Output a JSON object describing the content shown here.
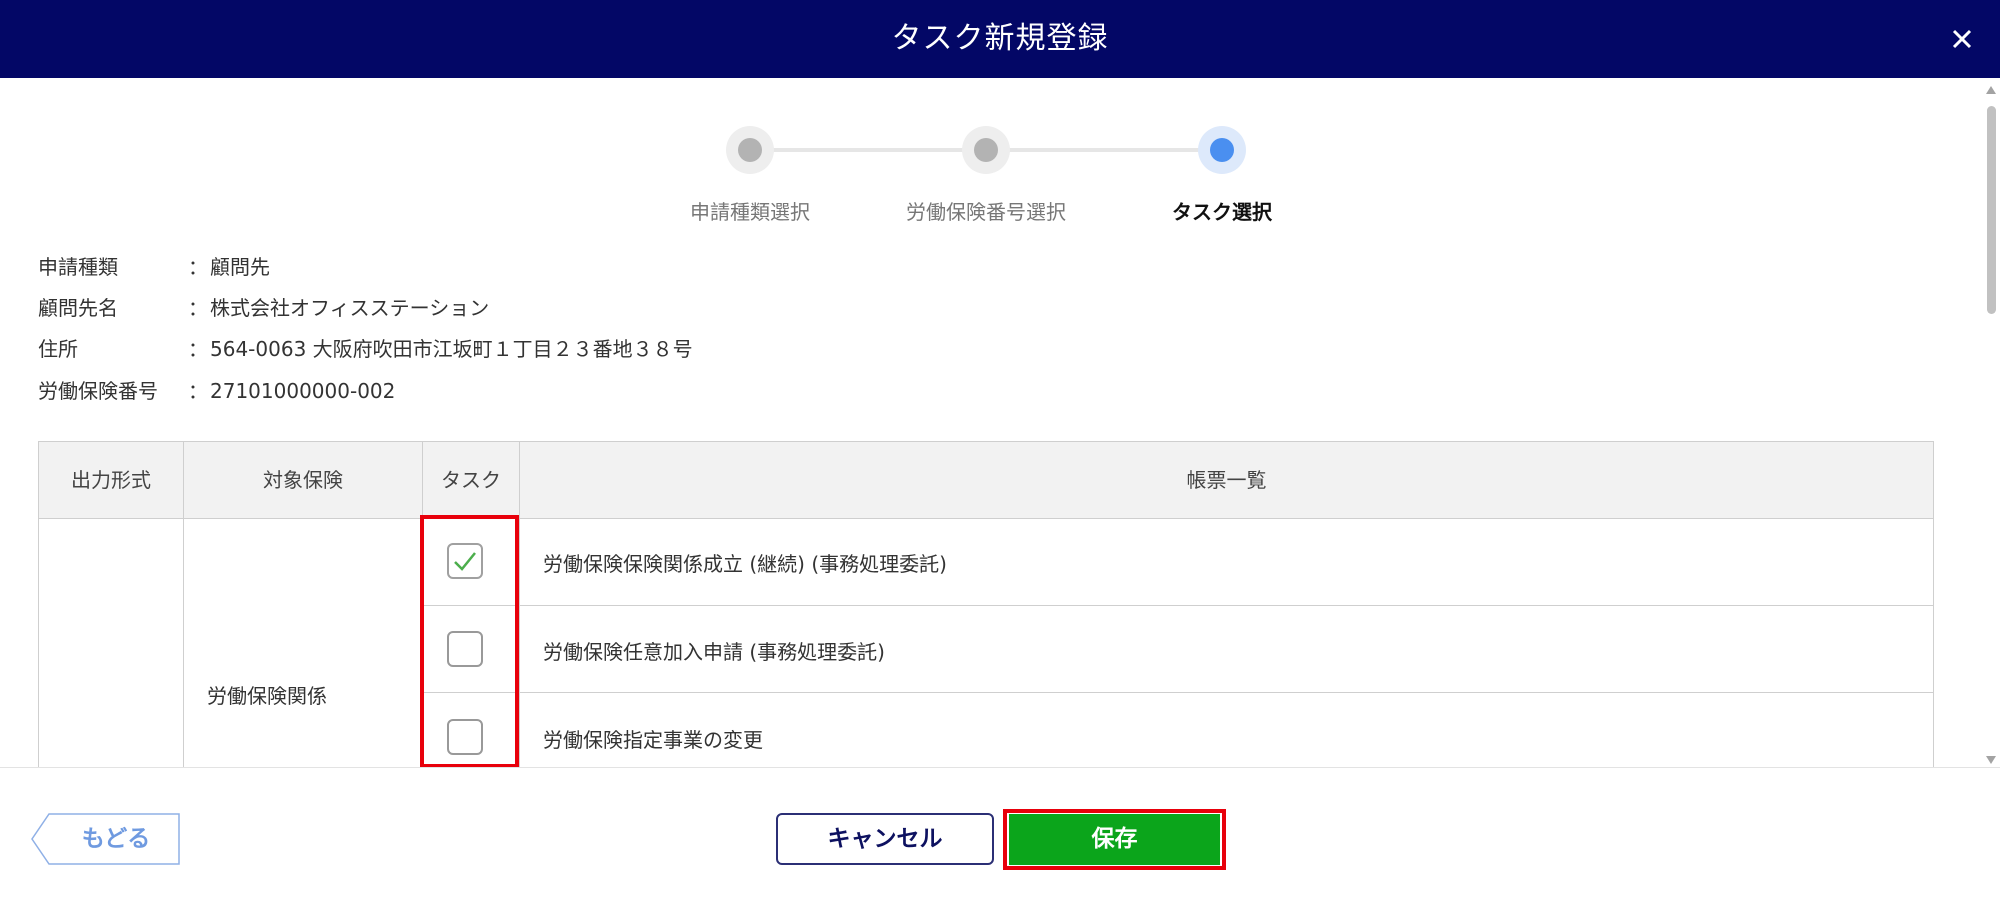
{
  "header": {
    "title": "タスク新規登録",
    "close_icon": "close-icon"
  },
  "stepper": {
    "steps": [
      {
        "label": "申請種類選択",
        "state": "done"
      },
      {
        "label": "労働保険番号選択",
        "state": "done"
      },
      {
        "label": "タスク選択",
        "state": "active"
      }
    ]
  },
  "info": [
    {
      "label": "申請種類",
      "colon": "：",
      "value": "顧問先"
    },
    {
      "label": "顧問先名",
      "colon": "：",
      "value": "株式会社オフィスステーション"
    },
    {
      "label": "住所",
      "colon": "：",
      "value": "564-0063 大阪府吹田市江坂町１丁目２３番地３８号"
    },
    {
      "label": "労働保険番号",
      "colon": "：",
      "value": "27101000000-002"
    }
  ],
  "table": {
    "headers": [
      "出力形式",
      "対象保険",
      "タスク",
      "帳票一覧"
    ],
    "insurance_group": "労働保険関係",
    "rows": [
      {
        "checked": true,
        "form": "労働保険保険関係成立 (継続) (事務処理委託)"
      },
      {
        "checked": false,
        "form": "労働保険任意加入申請 (事務処理委託)"
      },
      {
        "checked": false,
        "form": "労働保険指定事業の変更"
      }
    ]
  },
  "footer": {
    "back_label": "もどる",
    "cancel_label": "キャンセル",
    "save_label": "保存"
  },
  "colors": {
    "header_bg": "#030766",
    "save_bg": "#0ba51b",
    "highlight": "#e8000b",
    "step_active": "#4a8ff0",
    "checkmark": "#4cae4c"
  }
}
